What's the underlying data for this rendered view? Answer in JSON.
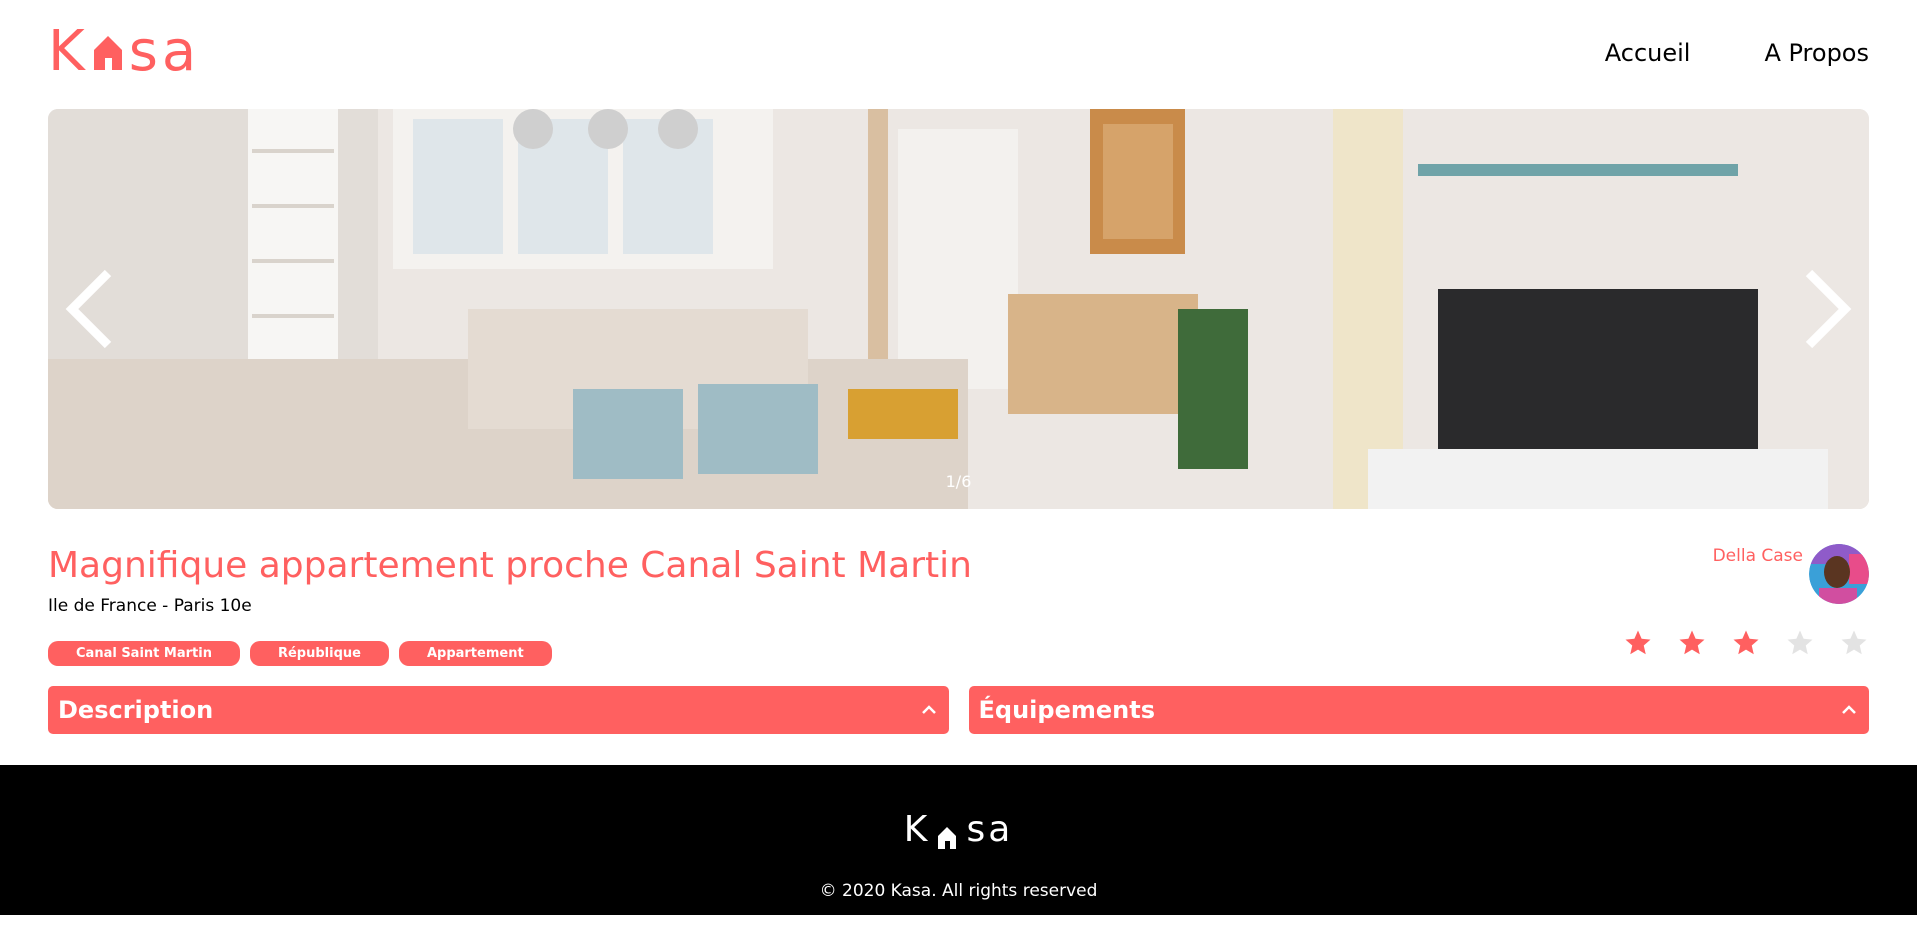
{
  "brand": {
    "name_start": "K",
    "name_end": "sa",
    "accent_color": "#FF6060"
  },
  "nav": {
    "home": "Accueil",
    "about": "A Propos"
  },
  "carousel": {
    "counter": "1/6",
    "prev_icon": "chevron-left-icon",
    "next_icon": "chevron-right-icon"
  },
  "listing": {
    "title": "Magnifique appartement proche Canal Saint Martin",
    "location": "Ile de France - Paris 10e",
    "tags": [
      "Canal Saint Martin",
      "République",
      "Appartement"
    ],
    "host_name": "Della Case",
    "rating": 3,
    "rating_max": 5
  },
  "collapses": {
    "description": "Description",
    "equipment": "Équipements"
  },
  "footer": {
    "copyright": "© 2020 Kasa. All rights reserved"
  }
}
